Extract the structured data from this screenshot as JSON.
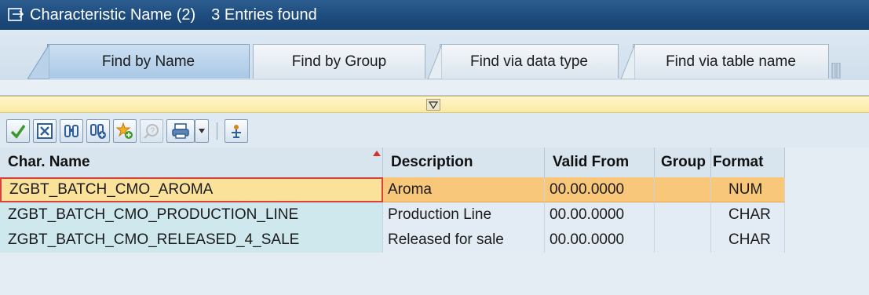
{
  "window": {
    "title": "Characteristic Name (2)",
    "entries": "3 Entries found"
  },
  "tabs": [
    {
      "label": "Find by Name",
      "active": true
    },
    {
      "label": "Find by Group",
      "active": false
    },
    {
      "label": "Find via data type",
      "active": false
    },
    {
      "label": "Find via table name",
      "active": false
    }
  ],
  "toolbar": {
    "buttons": [
      {
        "name": "continue-icon",
        "color": "#3a9a2a"
      },
      {
        "name": "cancel-icon",
        "color": "#2f5f9a"
      },
      {
        "name": "find-icon",
        "color": "#2f5f9a"
      },
      {
        "name": "find-next-icon",
        "color": "#2f5f9a"
      },
      {
        "name": "new-entry-icon",
        "color": "#d48a1a"
      },
      {
        "name": "help-icon",
        "color": "#a0a0a0"
      },
      {
        "name": "print-icon",
        "color": "#2f5f9a"
      },
      {
        "name": "personal-list-icon",
        "color": "#2f5f9a"
      }
    ]
  },
  "table": {
    "columns": [
      "Char. Name",
      "Description",
      "Valid From",
      "Group",
      "Format"
    ],
    "rows": [
      {
        "name": "ZGBT_BATCH_CMO_AROMA",
        "description": "Aroma",
        "valid_from": "00.00.0000",
        "group": "",
        "format": "NUM",
        "selected": true
      },
      {
        "name": "ZGBT_BATCH_CMO_PRODUCTION_LINE",
        "description": "Production Line",
        "valid_from": "00.00.0000",
        "group": "",
        "format": "CHAR",
        "selected": false
      },
      {
        "name": "ZGBT_BATCH_CMO_RELEASED_4_SALE",
        "description": "Released for sale",
        "valid_from": "00.00.0000",
        "group": "",
        "format": "CHAR",
        "selected": false
      }
    ]
  },
  "colors": {
    "title_bg": "#1e4d80",
    "selected_row": "#f8c77a",
    "sort_indicator": "#d6312a"
  }
}
